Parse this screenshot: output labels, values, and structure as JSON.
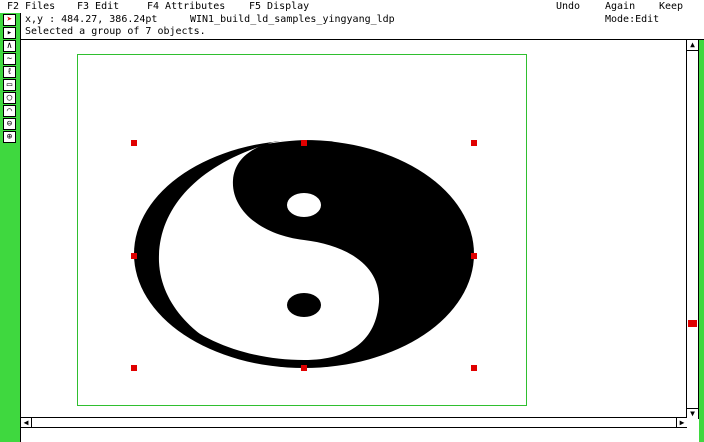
{
  "menubar": {
    "files": "F2 Files",
    "edit": "F3 Edit",
    "attributes": "F4 Attributes",
    "display": "F5 Display",
    "undo": "Undo",
    "again": "Again",
    "keep": "Keep"
  },
  "status": {
    "coords": "x,y :  484.27,  386.24pt",
    "filename": "WIN1_build_ld_samples_yingyang_ldp",
    "mode": "Mode:Edit",
    "message": "Selected a group of 7 objects."
  },
  "tools": [
    {
      "name": "select-pointer-icon",
      "glyph": "➤"
    },
    {
      "name": "arrow-tool-icon",
      "glyph": "▸"
    },
    {
      "name": "polyline-tool-icon",
      "glyph": "∧"
    },
    {
      "name": "curve-tool-icon",
      "glyph": "∼"
    },
    {
      "name": "text-tool-icon",
      "glyph": "ℓ"
    },
    {
      "name": "rectangle-tool-icon",
      "glyph": "▭"
    },
    {
      "name": "ellipse-tool-icon",
      "glyph": "◯"
    },
    {
      "name": "arc-tool-icon",
      "glyph": "⌒"
    },
    {
      "name": "zoom-out-icon",
      "glyph": "⊖"
    },
    {
      "name": "zoom-in-icon",
      "glyph": "⊕"
    }
  ],
  "colors": {
    "toolbox": "#3fd83f",
    "page_frame": "#2fbf2f",
    "selection_handle": "#e00000"
  }
}
